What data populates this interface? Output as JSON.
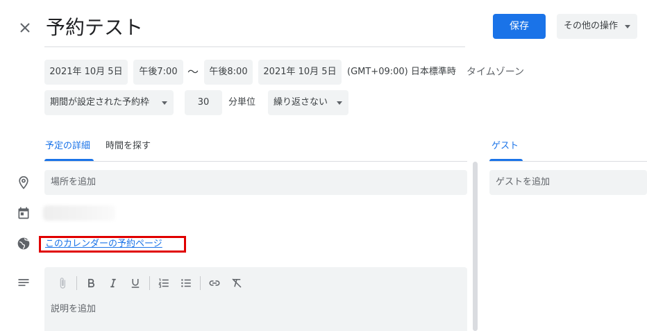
{
  "header": {
    "title": "予約テスト",
    "save_label": "保存",
    "more_label": "その他の操作"
  },
  "datetime": {
    "start_date": "2021年 10月 5日",
    "start_time": "午後7:00",
    "separator": "～",
    "end_time": "午後8:00",
    "end_date": "2021年 10月 5日",
    "timezone": "(GMT+09:00) 日本標準時",
    "timezone_link": "タイムゾーン"
  },
  "options": {
    "slot_type": "期間が設定された予約枠",
    "duration": "30",
    "duration_unit": "分単位",
    "repeat": "繰り返さない"
  },
  "tabs": [
    {
      "label": "予定の詳細",
      "active": true
    },
    {
      "label": "時間を探す",
      "active": false
    }
  ],
  "details": {
    "location_placeholder": "場所を追加",
    "booking_page_link": "このカレンダーの予約ページ",
    "description_placeholder": "説明を追加"
  },
  "guests": {
    "tab_label": "ゲスト",
    "add_placeholder": "ゲストを追加"
  },
  "colors": {
    "accent": "#1a73e8",
    "highlight_box": "#e00000",
    "chip_bg": "#f1f3f4"
  },
  "icons": [
    "close-icon",
    "location-icon",
    "calendar-icon",
    "globe-icon",
    "notes-icon",
    "attachment-icon",
    "bold-icon",
    "italic-icon",
    "underline-icon",
    "numbered-list-icon",
    "bulleted-list-icon",
    "link-icon",
    "remove-format-icon"
  ]
}
